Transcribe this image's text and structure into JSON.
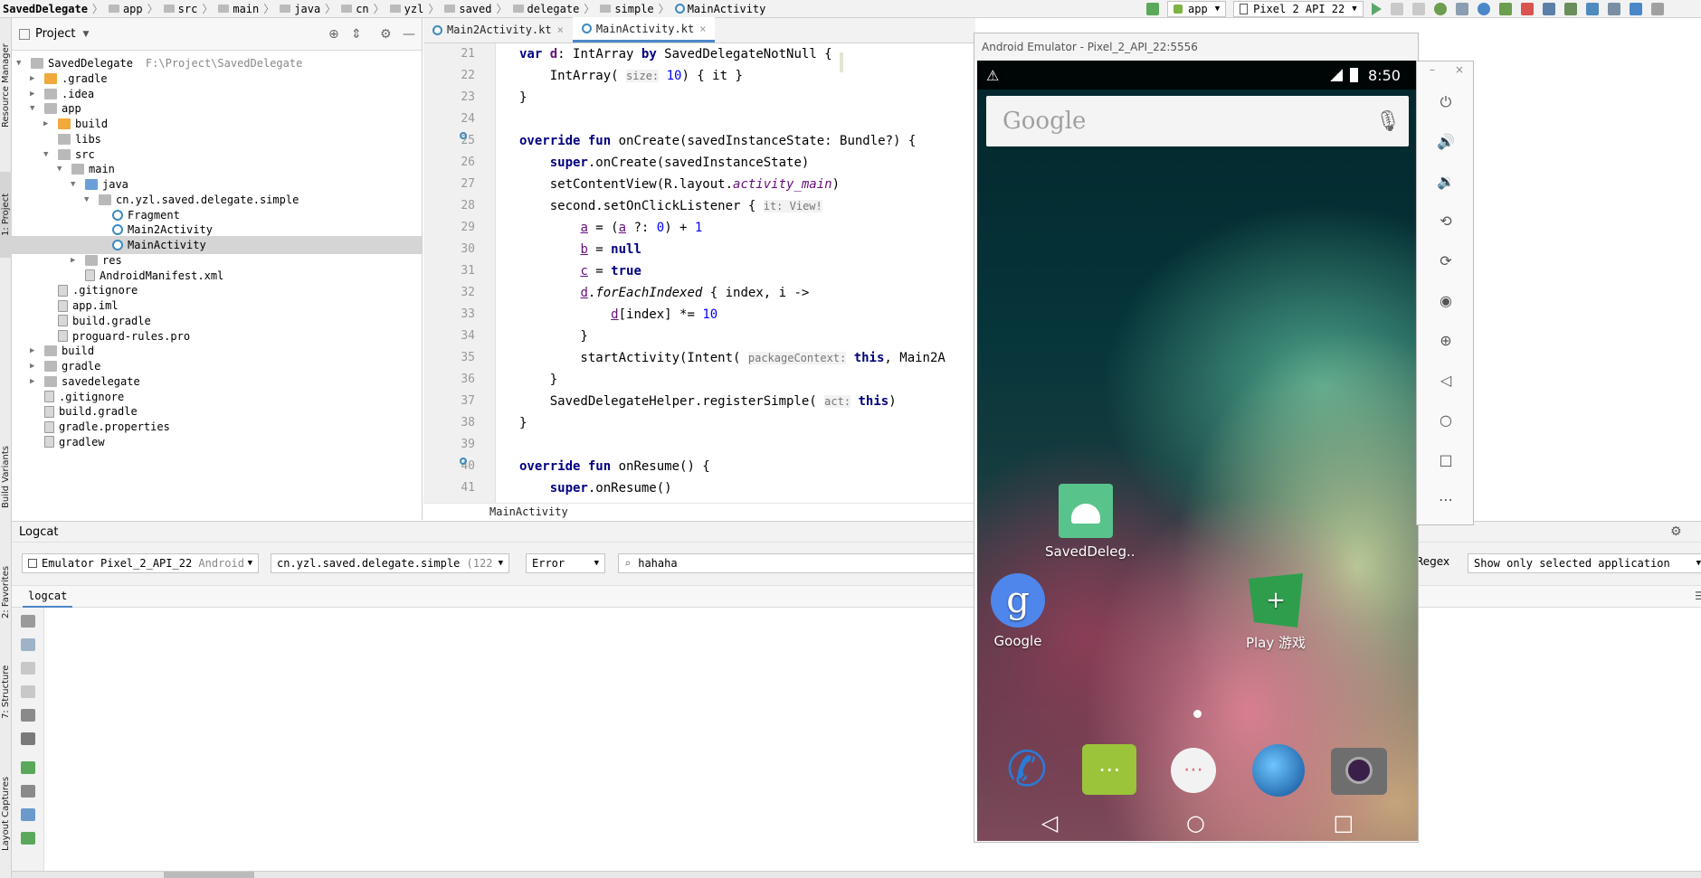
{
  "breadcrumb": [
    "SavedDelegate",
    "app",
    "src",
    "main",
    "java",
    "cn",
    "yzl",
    "saved",
    "delegate",
    "simple",
    "MainActivity"
  ],
  "toolbar": {
    "config": "app",
    "device": "Pixel 2 API 22"
  },
  "left_tabs": {
    "resource_manager": "Resource Manager",
    "project": "1: Project",
    "build_variants": "Build Variants",
    "favorites": "2: Favorites",
    "structure": "7: Structure",
    "layout_captures": "Layout Captures"
  },
  "project": {
    "title": "Project",
    "tree": [
      {
        "label": "SavedDelegate",
        "path": "F:\\Project\\SavedDelegate",
        "depth": 0,
        "arrow": "▼",
        "icon": "folder"
      },
      {
        "label": ".gradle",
        "depth": 1,
        "arrow": "▶",
        "icon": "orange"
      },
      {
        "label": ".idea",
        "depth": 1,
        "arrow": "▶",
        "icon": "folder"
      },
      {
        "label": "app",
        "depth": 1,
        "arrow": "▼",
        "icon": "folder"
      },
      {
        "label": "build",
        "depth": 2,
        "arrow": "▶",
        "icon": "orange"
      },
      {
        "label": "libs",
        "depth": 2,
        "arrow": "",
        "icon": "folder"
      },
      {
        "label": "src",
        "depth": 2,
        "arrow": "▼",
        "icon": "folder"
      },
      {
        "label": "main",
        "depth": 3,
        "arrow": "▼",
        "icon": "folder"
      },
      {
        "label": "java",
        "depth": 4,
        "arrow": "▼",
        "icon": "blue"
      },
      {
        "label": "cn.yzl.saved.delegate.simple",
        "depth": 5,
        "arrow": "▼",
        "icon": "folder"
      },
      {
        "label": "Fragment",
        "depth": 6,
        "arrow": "",
        "icon": "kclass"
      },
      {
        "label": "Main2Activity",
        "depth": 6,
        "arrow": "",
        "icon": "kclass"
      },
      {
        "label": "MainActivity",
        "depth": 6,
        "arrow": "",
        "icon": "kclass",
        "selected": true
      },
      {
        "label": "res",
        "depth": 4,
        "arrow": "▶",
        "icon": "folder"
      },
      {
        "label": "AndroidManifest.xml",
        "depth": 4,
        "arrow": "",
        "icon": "file"
      },
      {
        "label": ".gitignore",
        "depth": 2,
        "arrow": "",
        "icon": "file"
      },
      {
        "label": "app.iml",
        "depth": 2,
        "arrow": "",
        "icon": "file"
      },
      {
        "label": "build.gradle",
        "depth": 2,
        "arrow": "",
        "icon": "file"
      },
      {
        "label": "proguard-rules.pro",
        "depth": 2,
        "arrow": "",
        "icon": "file"
      },
      {
        "label": "build",
        "depth": 1,
        "arrow": "▶",
        "icon": "folder"
      },
      {
        "label": "gradle",
        "depth": 1,
        "arrow": "▶",
        "icon": "folder"
      },
      {
        "label": "savedelegate",
        "depth": 1,
        "arrow": "▶",
        "icon": "folder"
      },
      {
        "label": ".gitignore",
        "depth": 1,
        "arrow": "",
        "icon": "file"
      },
      {
        "label": "build.gradle",
        "depth": 1,
        "arrow": "",
        "icon": "file"
      },
      {
        "label": "gradle.properties",
        "depth": 1,
        "arrow": "",
        "icon": "file"
      },
      {
        "label": "gradlew",
        "depth": 1,
        "arrow": "",
        "icon": "file"
      }
    ]
  },
  "tabs": [
    {
      "label": "Main2Activity.kt"
    },
    {
      "label": "MainActivity.kt",
      "active": true
    }
  ],
  "editor": {
    "line_numbers": [
      "21",
      "22",
      "23",
      "24",
      "25",
      "26",
      "27",
      "28",
      "29",
      "30",
      "31",
      "32",
      "33",
      "34",
      "35",
      "36",
      "37",
      "38",
      "39",
      "40",
      "41"
    ],
    "footer": "MainActivity"
  },
  "logcat": {
    "title": "Logcat",
    "device": "Emulator Pixel_2_API_22",
    "device_suffix": "Android",
    "package": "cn.yzl.saved.delegate.simple",
    "pid": "(122",
    "level": "Error",
    "search": "hahaha",
    "regex": "Regex",
    "filter": "Show only selected application",
    "tab": "logcat"
  },
  "emulator": {
    "title": "Android Emulator - Pixel_2_API_22:5556",
    "time": "8:50",
    "search_brand": "Google",
    "apps": [
      {
        "label": "SavedDeleg..",
        "icon": "android-app-icon"
      },
      {
        "label": "Google",
        "icon": "google-g-icon"
      },
      {
        "label": "Play 游戏",
        "icon": "play-games-icon"
      }
    ],
    "dock": [
      "phone-icon",
      "messaging-icon",
      "app-drawer-icon",
      "browser-icon",
      "camera-icon"
    ]
  }
}
